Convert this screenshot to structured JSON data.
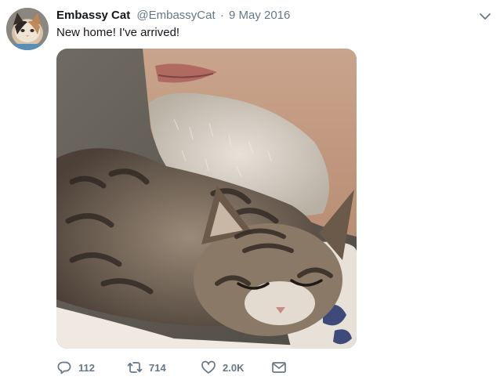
{
  "tweet": {
    "author_name": "Embassy Cat",
    "author_handle": "@EmbassyCat",
    "separator": "·",
    "date": "9 May 2016",
    "text": "New home! I've arrived!",
    "media_alt": "Photo of a sleeping tabby kitten nestled against a bearded man's neck"
  },
  "actions": {
    "reply_count": "112",
    "retweet_count": "714",
    "like_count": "2.0K"
  },
  "colors": {
    "text_primary": "#14171a",
    "text_secondary": "#657786",
    "background": "#ffffff"
  },
  "icons": {
    "menu": "chevron-down-icon",
    "reply": "reply-icon",
    "retweet": "retweet-icon",
    "like": "heart-icon",
    "message": "envelope-icon"
  }
}
